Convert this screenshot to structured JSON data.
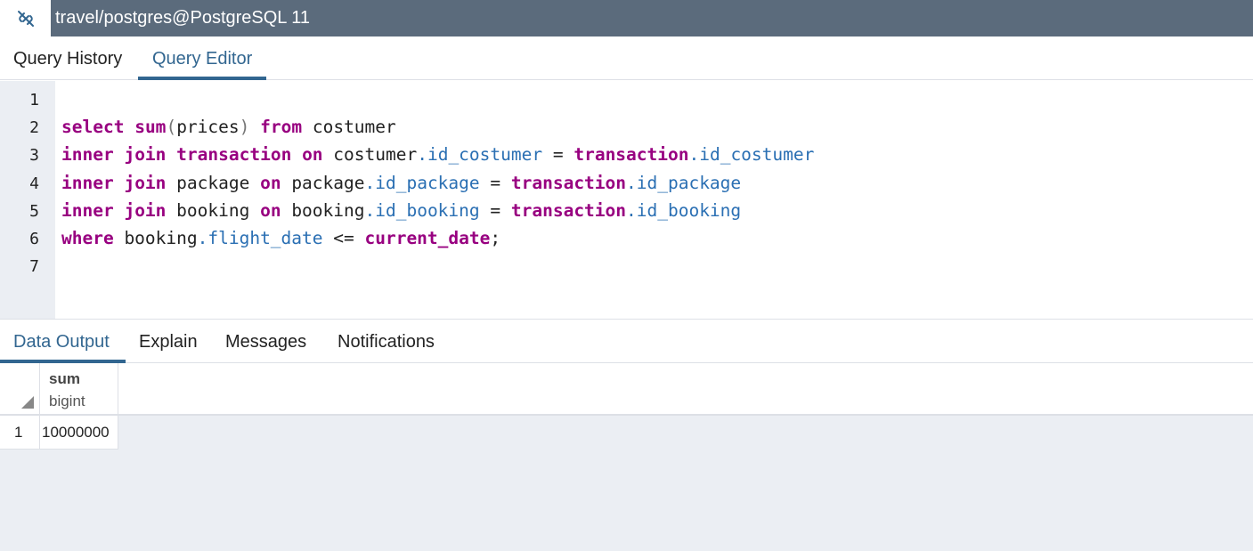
{
  "window": {
    "title": "travel/postgres@PostgreSQL 11",
    "connection_icon": "connection-link-icon",
    "title_bar_color": "#5b6b7c"
  },
  "editor_tabs": [
    {
      "label": "Query History",
      "active": false
    },
    {
      "label": "Query Editor",
      "active": true
    }
  ],
  "accent_color": "#326690",
  "editor": {
    "line_numbers": [
      "1",
      "2",
      "3",
      "4",
      "5",
      "6",
      "7"
    ],
    "lines": [
      "",
      "select sum(prices) from costumer",
      "inner join transaction on costumer.id_costumer = transaction.id_costumer",
      "inner join package on package.id_package = transaction.id_package",
      "inner join booking on booking.id_booking = transaction.id_booking",
      "where booking.flight_date <= current_date;",
      ""
    ],
    "keyword_color": "#980080",
    "field_color": "#2a6fb3"
  },
  "output_tabs": [
    {
      "label": "Data Output",
      "active": true
    },
    {
      "label": "Explain",
      "active": false
    },
    {
      "label": "Messages",
      "active": false
    },
    {
      "label": "Notifications",
      "active": false
    }
  ],
  "grid": {
    "columns": [
      {
        "name": "sum",
        "type": "bigint"
      }
    ],
    "rows": [
      {
        "row_number": "1",
        "values": [
          "10000000"
        ]
      }
    ]
  }
}
